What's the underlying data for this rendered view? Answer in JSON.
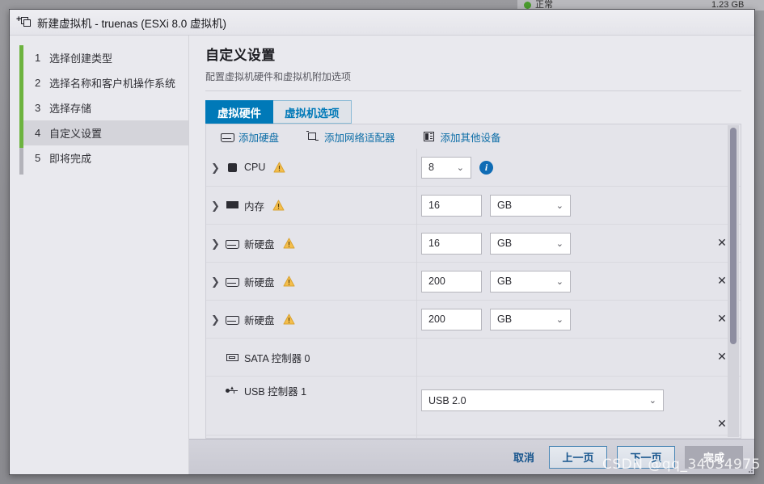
{
  "backdrop": {
    "status_text": "正常",
    "right_text": "1.23 GB"
  },
  "window": {
    "title": "新建虚拟机 - truenas (ESXi 8.0 虚拟机)",
    "icon": "new-vm-icon"
  },
  "steps": {
    "items": [
      {
        "num": "1",
        "label": "选择创建类型",
        "active": false
      },
      {
        "num": "2",
        "label": "选择名称和客户机操作系统",
        "active": false
      },
      {
        "num": "3",
        "label": "选择存储",
        "active": false
      },
      {
        "num": "4",
        "label": "自定义设置",
        "active": true
      },
      {
        "num": "5",
        "label": "即将完成",
        "active": false
      }
    ]
  },
  "page": {
    "title": "自定义设置",
    "subtitle": "配置虚拟机硬件和虚拟机附加选项"
  },
  "tabs": [
    {
      "label": "虚拟硬件",
      "active": true
    },
    {
      "label": "虚拟机选项",
      "active": false
    }
  ],
  "toolbar": [
    {
      "label": "添加硬盘",
      "icon": "disk-icon"
    },
    {
      "label": "添加网络适配器",
      "icon": "network-adapter-icon"
    },
    {
      "label": "添加其他设备",
      "icon": "other-device-icon"
    }
  ],
  "hardware_rows": [
    {
      "name": "CPU",
      "icon": "cpu-icon",
      "expandable": true,
      "warning": true,
      "value": "8",
      "value_kind": "select",
      "info": true,
      "removable": false
    },
    {
      "name": "内存",
      "icon": "memory-icon",
      "expandable": true,
      "warning": true,
      "value": "16",
      "value_kind": "number",
      "unit": "GB",
      "removable": false
    },
    {
      "name": "新硬盘",
      "icon": "disk-icon",
      "expandable": true,
      "warning": true,
      "value": "16",
      "value_kind": "number",
      "unit": "GB",
      "removable": true
    },
    {
      "name": "新硬盘",
      "icon": "disk-icon",
      "expandable": true,
      "warning": true,
      "value": "200",
      "value_kind": "number",
      "unit": "GB",
      "removable": true
    },
    {
      "name": "新硬盘",
      "icon": "disk-icon",
      "expandable": true,
      "warning": true,
      "value": "200",
      "value_kind": "number",
      "unit": "GB",
      "removable": true
    },
    {
      "name": "SATA 控制器 0",
      "icon": "sata-controller-icon",
      "expandable": false,
      "warning": false,
      "removable": true
    },
    {
      "name": "USB 控制器 1",
      "icon": "usb-controller-icon",
      "expandable": false,
      "warning": false,
      "value": "USB 2.0",
      "value_kind": "select-wide",
      "removable": true
    }
  ],
  "footer": {
    "cancel": "取消",
    "back": "上一页",
    "next": "下一页",
    "finish": "完成"
  },
  "watermark": "CSDN @qq_34034975",
  "colors": {
    "accent_blue": "#0079b8",
    "link_blue": "#0a6ca6",
    "progress_green": "#6db33f",
    "warning_amber": "#f5be4b",
    "info_blue": "#0f6cb5"
  },
  "glyphs": {
    "chevron_right": "❯",
    "chevron_down": "⌄",
    "close": "✕",
    "plus": "+"
  }
}
